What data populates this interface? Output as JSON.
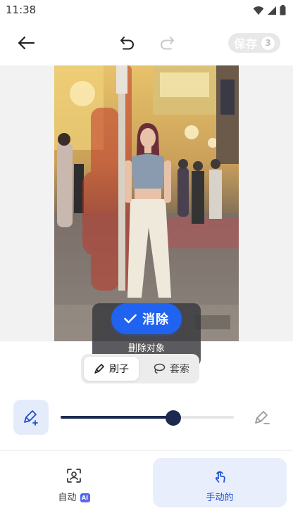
{
  "status_bar": {
    "time": "11:38"
  },
  "toolbar": {
    "save_label": "保存",
    "save_count": "3"
  },
  "loading": {
    "text": "删除对象"
  },
  "erase": {
    "label": "消除"
  },
  "mode": {
    "brush_label": "刷子",
    "lasso_label": "套索",
    "selected": "brush"
  },
  "brush_size": {
    "value": 0.65
  },
  "bottom_tabs": {
    "auto_label": "自动",
    "auto_badge": "AI",
    "manual_label": "手动的",
    "selected": "manual"
  },
  "colors": {
    "accent": "#1f63f0",
    "slider": "#1b2a4e",
    "mask": "#c0392b"
  }
}
